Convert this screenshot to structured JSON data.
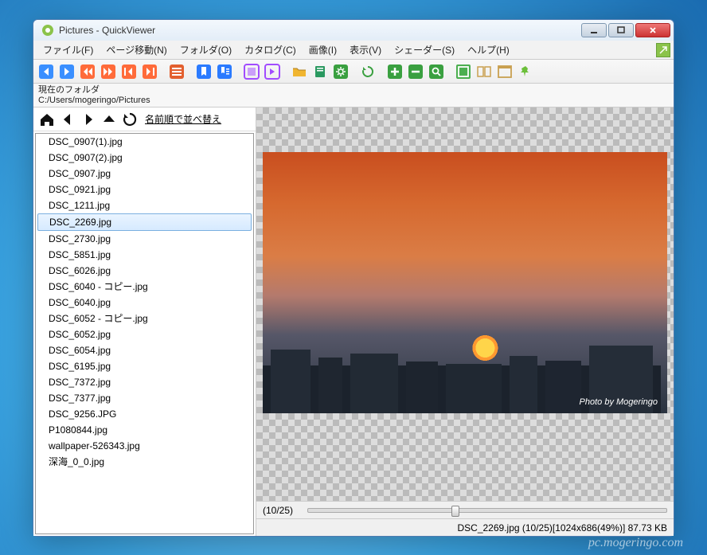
{
  "window": {
    "title": "Pictures - QuickViewer"
  },
  "menubar": {
    "items": [
      "ファイル(F)",
      "ページ移動(N)",
      "フォルダ(O)",
      "カタログ(C)",
      "画像(I)",
      "表示(V)",
      "シェーダー(S)",
      "ヘルプ(H)"
    ]
  },
  "path": {
    "label": "現在のフォルダ",
    "value": "C:/Users/mogeringo/Pictures"
  },
  "sidebar": {
    "sortlabel": "名前順で並べ替え",
    "files": [
      "DSC_0907(1).jpg",
      "DSC_0907(2).jpg",
      "DSC_0907.jpg",
      "DSC_0921.jpg",
      "DSC_1211.jpg",
      "DSC_2269.jpg",
      "DSC_2730.jpg",
      "DSC_5851.jpg",
      "DSC_6026.jpg",
      "DSC_6040 - コピー.jpg",
      "DSC_6040.jpg",
      "DSC_6052 - コピー.jpg",
      "DSC_6052.jpg",
      "DSC_6054.jpg",
      "DSC_6195.jpg",
      "DSC_7372.jpg",
      "DSC_7377.jpg",
      "DSC_9256.JPG",
      "P1080844.jpg",
      "wallpaper-526343.jpg",
      "深海_0_0.jpg"
    ],
    "selected_index": 5
  },
  "viewer": {
    "credit": "Photo by Mogeringo",
    "slider_label": "(10/25)",
    "slider_percent": 40,
    "status": "DSC_2269.jpg (10/25)[1024x686(49%)] 87.73 KB"
  },
  "watermark": "pc.mogeringo.com",
  "toolbar_icons": [
    "nav-prev",
    "nav-next",
    "fast-back",
    "fast-fwd",
    "first",
    "last",
    "list-toggle",
    "bookmark-add",
    "bookmark-list",
    "view-purple-a",
    "view-purple-b",
    "folder-open",
    "book",
    "settings",
    "rotate",
    "zoom-in",
    "zoom-out",
    "search",
    "fit-green",
    "dual-page",
    "fullscreen",
    "pin"
  ],
  "colors": {
    "nav": "#3a8fff",
    "fast": "#ff6b3a",
    "list": "#e3602f",
    "bookmark": "#2b7bff",
    "purple": "#a14cff",
    "folder": "#f0b530",
    "book": "#2a9960",
    "gear": "#3aa040",
    "rotate": "#3aa040",
    "plus": "#3aa040",
    "minus": "#3aa040",
    "search": "#3aa040",
    "fit": "#4caf50",
    "dual": "#c9a050",
    "full": "#c9a050",
    "pin": "#6cbf3a"
  }
}
